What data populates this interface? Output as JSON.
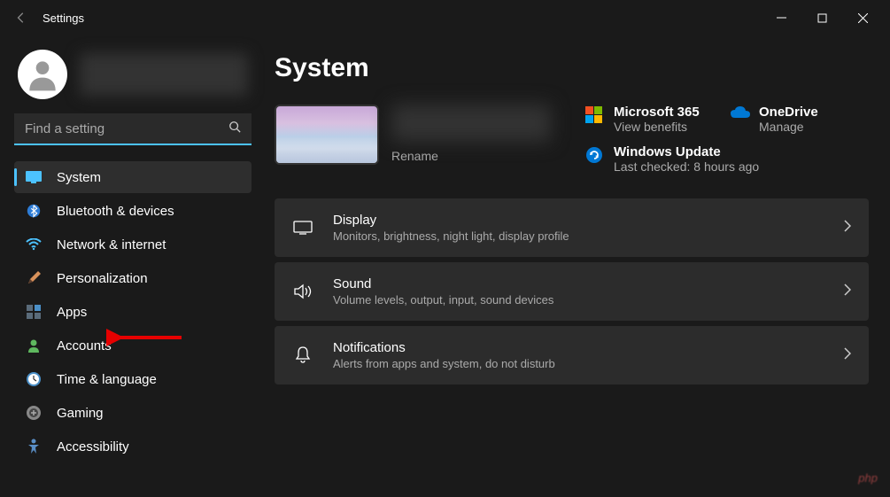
{
  "window": {
    "title": "Settings"
  },
  "search": {
    "placeholder": "Find a setting"
  },
  "nav": {
    "items": [
      {
        "label": "System"
      },
      {
        "label": "Bluetooth & devices"
      },
      {
        "label": "Network & internet"
      },
      {
        "label": "Personalization"
      },
      {
        "label": "Apps"
      },
      {
        "label": "Accounts"
      },
      {
        "label": "Time & language"
      },
      {
        "label": "Gaming"
      },
      {
        "label": "Accessibility"
      }
    ]
  },
  "page": {
    "title": "System",
    "rename": "Rename"
  },
  "services": {
    "ms365": {
      "title": "Microsoft 365",
      "sub": "View benefits"
    },
    "onedrive": {
      "title": "OneDrive",
      "sub": "Manage"
    },
    "update": {
      "title": "Windows Update",
      "sub": "Last checked: 8 hours ago"
    }
  },
  "cards": {
    "display": {
      "title": "Display",
      "sub": "Monitors, brightness, night light, display profile"
    },
    "sound": {
      "title": "Sound",
      "sub": "Volume levels, output, input, sound devices"
    },
    "notifications": {
      "title": "Notifications",
      "sub": "Alerts from apps and system, do not disturb"
    }
  },
  "watermark": "php"
}
